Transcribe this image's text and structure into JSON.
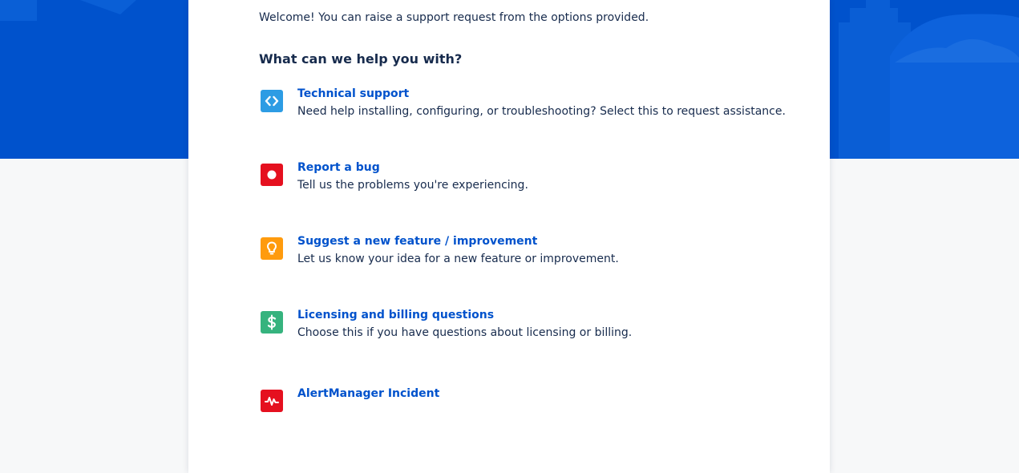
{
  "intro": {
    "welcome_text": "Welcome! You can raise a support request from the options provided.",
    "heading": "What can we help you with?"
  },
  "theme": {
    "banner_color": "#0052cc",
    "link_color": "#0052cc",
    "text_color": "#172b4d"
  },
  "request_types": [
    {
      "title": "Technical support",
      "description": "Need help installing, configuring, or troubleshooting? Select this to request assistance.",
      "icon": "code-brackets-icon",
      "icon_color": "#2d9ce4"
    },
    {
      "title": "Report a bug",
      "description": "Tell us the problems you're experiencing.",
      "icon": "bug-record-icon",
      "icon_color": "#e5101f"
    },
    {
      "title": "Suggest a new feature / improvement",
      "description": "Let us know your idea for a new feature or improvement.",
      "icon": "lightbulb-icon",
      "icon_color": "#ff9b0d"
    },
    {
      "title": "Licensing and billing questions",
      "description": "Choose this if you have questions about licensing or billing.",
      "icon": "dollar-icon",
      "icon_color": "#36b37e"
    },
    {
      "title": "AlertManager Incident",
      "description": "",
      "icon": "pulse-icon",
      "icon_color": "#e5101f"
    }
  ]
}
